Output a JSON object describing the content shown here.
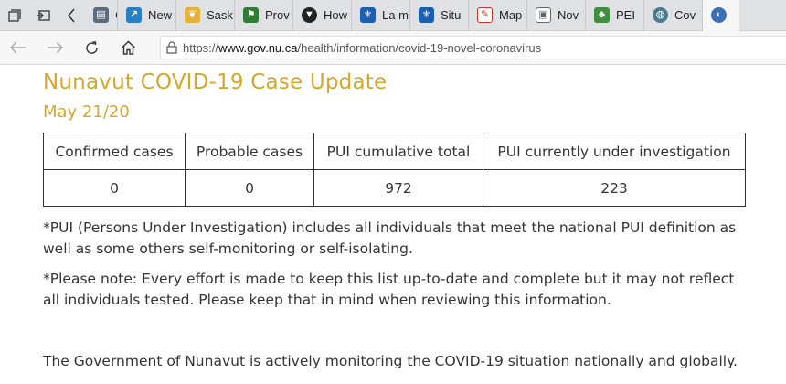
{
  "browser": {
    "tabs": [
      {
        "label": "Case",
        "icon": "page-icon",
        "color": "#5b6b80"
      },
      {
        "label": "New",
        "icon": "chart-icon",
        "color": "#2a7fc1"
      },
      {
        "label": "Sask",
        "icon": "leaf-icon",
        "color": "#e2b23a"
      },
      {
        "label": "Prov",
        "icon": "flag-icon",
        "color": "#2e7d32"
      },
      {
        "label": "How",
        "icon": "shield-icon",
        "color": "#222222"
      },
      {
        "label": "La m",
        "icon": "fleur-de-lis-icon",
        "color": "#1b5fb0"
      },
      {
        "label": "Situ",
        "icon": "fleur-de-lis-icon",
        "color": "#1b5fb0"
      },
      {
        "label": "Map",
        "icon": "pen-icon",
        "color": "#c0392b"
      },
      {
        "label": "Nov",
        "icon": "image-icon",
        "color": "#666666"
      },
      {
        "label": "PEI",
        "icon": "tree-icon",
        "color": "#3f8f3f"
      },
      {
        "label": "Cov",
        "icon": "globe-icon",
        "color": "#4a7a8c"
      },
      {
        "label": "",
        "icon": "nunavut-icon",
        "color": "#3b6fb6"
      }
    ],
    "url_prefix": "https://",
    "url_domain": "www.gov.nu.ca",
    "url_path": "/health/information/covid-19-novel-coronavirus"
  },
  "page": {
    "title": "Nunavut COVID-19 Case Update",
    "date": "May 21/20",
    "table": {
      "headers": [
        "Confirmed cases",
        "Probable cases",
        "PUI cumulative total",
        "PUI currently under investigation"
      ],
      "rows": [
        [
          "0",
          "0",
          "972",
          "223"
        ]
      ]
    },
    "note_pui": "*PUI (Persons Under Investigation) includes all individuals that meet the national PUI definition as well as some others self-monitoring or self-isolating.",
    "note_please": "*Please note: Every effort is made to keep this list up-to-date and complete but it may not reflect all individuals tested. Please keep that in mind when reviewing this information.",
    "paragraph": "The Government of Nunavut is actively monitoring the COVID-19 situation nationally and globally."
  },
  "colors": {
    "heading": "#d4a82c",
    "text": "#333333"
  }
}
